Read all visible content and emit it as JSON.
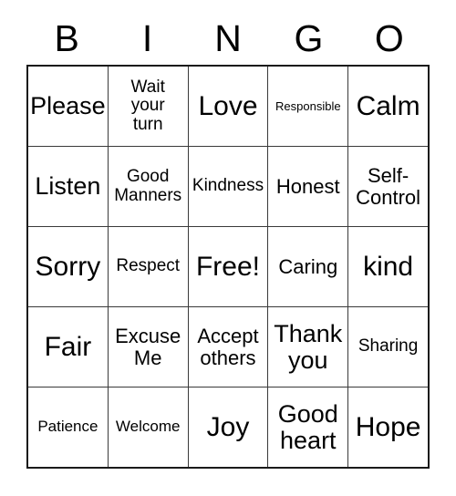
{
  "card": {
    "title": "BINGO",
    "headers": [
      "B",
      "I",
      "N",
      "G",
      "O"
    ],
    "rows": [
      [
        {
          "text": "Please",
          "size": "sz-lg"
        },
        {
          "text": "Wait\nyour\nturn",
          "size": "sz-md"
        },
        {
          "text": "Love",
          "size": "sz-xl"
        },
        {
          "text": "Responsible",
          "size": "sz-xs"
        },
        {
          "text": "Calm",
          "size": "sz-xl"
        }
      ],
      [
        {
          "text": "Listen",
          "size": "sz-lg"
        },
        {
          "text": "Good\nManners",
          "size": "sz-md"
        },
        {
          "text": "Kindness",
          "size": "sz-md"
        },
        {
          "text": "Honest",
          "size": "sz-mdl"
        },
        {
          "text": "Self-\nControl",
          "size": "sz-mdl"
        }
      ],
      [
        {
          "text": "Sorry",
          "size": "sz-xl"
        },
        {
          "text": "Respect",
          "size": "sz-md"
        },
        {
          "text": "Free!",
          "size": "sz-xl"
        },
        {
          "text": "Caring",
          "size": "sz-mdl"
        },
        {
          "text": "kind",
          "size": "sz-xl"
        }
      ],
      [
        {
          "text": "Fair",
          "size": "sz-xl"
        },
        {
          "text": "Excuse\nMe",
          "size": "sz-mdl"
        },
        {
          "text": "Accept\nothers",
          "size": "sz-mdl"
        },
        {
          "text": "Thank\nyou",
          "size": "sz-lg"
        },
        {
          "text": "Sharing",
          "size": "sz-md"
        }
      ],
      [
        {
          "text": "Patience",
          "size": "sz-sm"
        },
        {
          "text": "Welcome",
          "size": "sz-sm"
        },
        {
          "text": "Joy",
          "size": "sz-xl"
        },
        {
          "text": "Good\nheart",
          "size": "sz-lg"
        },
        {
          "text": "Hope",
          "size": "sz-xl"
        }
      ]
    ]
  }
}
